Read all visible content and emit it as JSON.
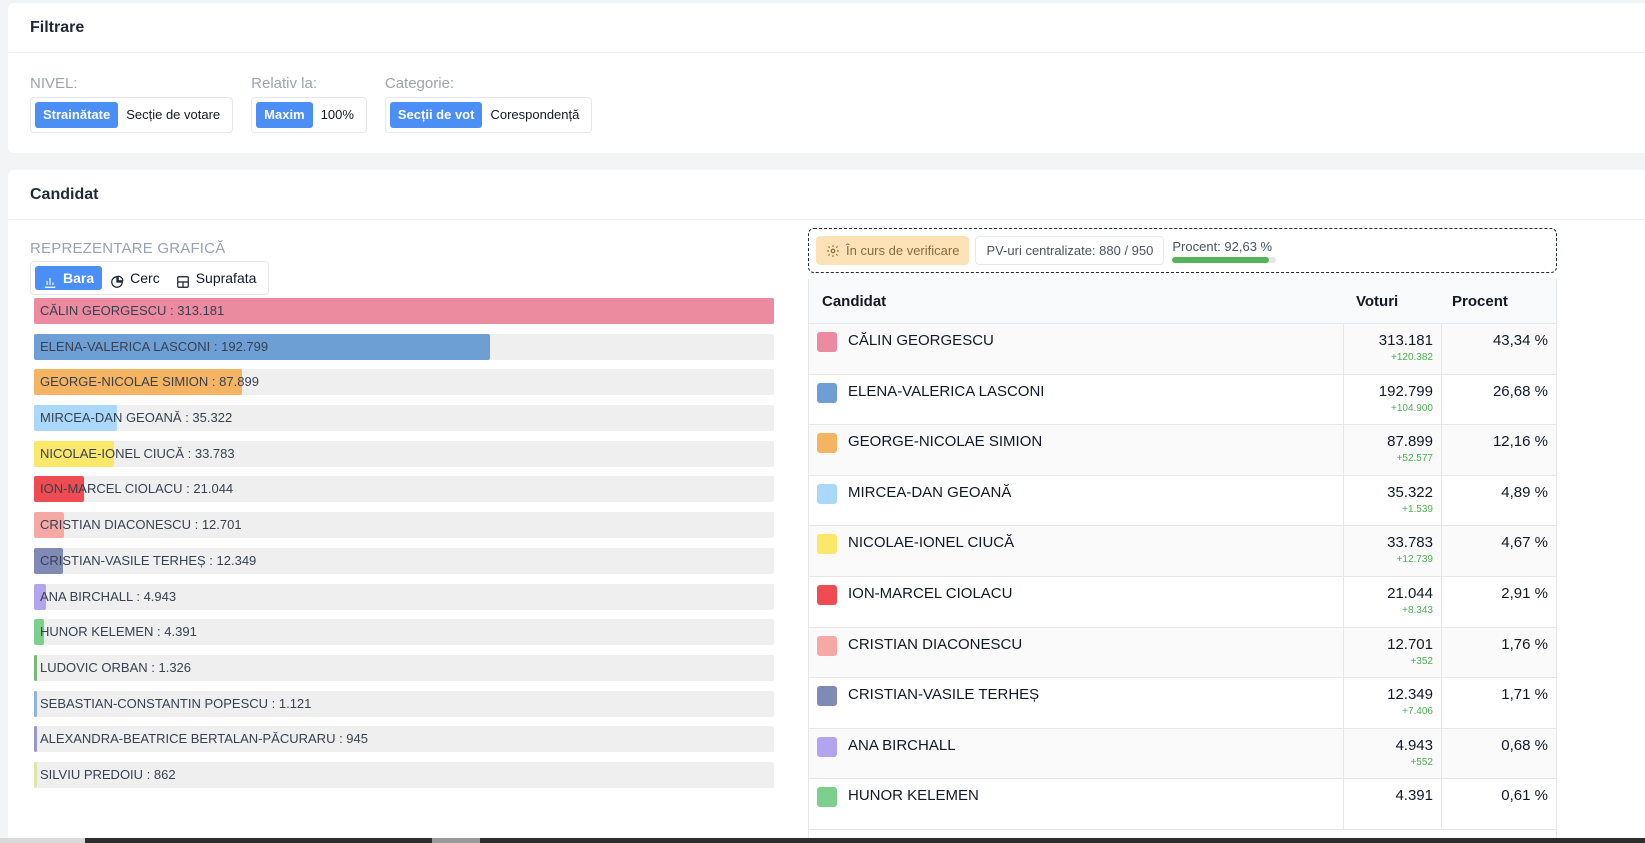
{
  "filters": {
    "title": "Filtrare",
    "groups": [
      {
        "label": "NIVEL:",
        "options": [
          "Strainătate",
          "Secție de votare"
        ],
        "active": 0
      },
      {
        "label": "Relativ la:",
        "options": [
          "Maxim",
          "100%"
        ],
        "active": 0
      },
      {
        "label": "Categorie:",
        "options": [
          "Secții de vot",
          "Corespondență"
        ],
        "active": 0
      }
    ]
  },
  "candidat": {
    "title": "Candidat",
    "chart_label": "REPREZENTARE GRAFICĂ",
    "chart_types": [
      "Bara",
      "Cerc",
      "Suprafata"
    ],
    "chart_type_icons": [
      "bar-chart-icon",
      "pie-chart-icon",
      "area-chart-icon"
    ],
    "active_chart_type": 0,
    "status": {
      "badge": "În curs de verificare",
      "badge_icon": "gear-icon",
      "pv": "PV-uri centralizate: 880 / 950",
      "percent_text": "Procent: 92,63 %",
      "percent_value": 92.63
    },
    "table": {
      "headers": [
        "Candidat",
        "Voturi",
        "Procent"
      ],
      "rows": [
        {
          "name": "CĂLIN GEORGESCU",
          "votes": "313.181",
          "delta": "+120.382",
          "pct": "43,34 %",
          "color": "#ec8aa0"
        },
        {
          "name": "ELENA-VALERICA LASCONI",
          "votes": "192.799",
          "delta": "+104.900",
          "pct": "26,68 %",
          "color": "#6e9fd4"
        },
        {
          "name": "GEORGE-NICOLAE SIMION",
          "votes": "87.899",
          "delta": "+52.577",
          "pct": "12,16 %",
          "color": "#f5b461"
        },
        {
          "name": "MIRCEA-DAN GEOANĂ",
          "votes": "35.322",
          "delta": "+1.539",
          "pct": "4,89 %",
          "color": "#a9d8fb"
        },
        {
          "name": "NICOLAE-IONEL CIUCĂ",
          "votes": "33.783",
          "delta": "+12.739",
          "pct": "4,67 %",
          "color": "#fbe86a"
        },
        {
          "name": "ION-MARCEL CIOLACU",
          "votes": "21.044",
          "delta": "+8.343",
          "pct": "2,91 %",
          "color": "#ee4c52"
        },
        {
          "name": "CRISTIAN DIACONESCU",
          "votes": "12.701",
          "delta": "+352",
          "pct": "1,76 %",
          "color": "#f6a9a4"
        },
        {
          "name": "CRISTIAN-VASILE TERHEȘ",
          "votes": "12.349",
          "delta": "+7.406",
          "pct": "1,71 %",
          "color": "#7f8ab5"
        },
        {
          "name": "ANA BIRCHALL",
          "votes": "4.943",
          "delta": "+552",
          "pct": "0,68 %",
          "color": "#b3a4ef"
        },
        {
          "name": "HUNOR KELEMEN",
          "votes": "4.391",
          "delta": "",
          "pct": "0,61 %",
          "color": "#7ccf8d"
        }
      ]
    }
  },
  "chart_data": {
    "type": "bar",
    "orientation": "horizontal",
    "categories": [
      "CĂLIN GEORGESCU",
      "ELENA-VALERICA LASCONI",
      "GEORGE-NICOLAE SIMION",
      "MIRCEA-DAN GEOANĂ",
      "NICOLAE-IONEL CIUCĂ",
      "ION-MARCEL CIOLACU",
      "CRISTIAN DIACONESCU",
      "CRISTIAN-VASILE TERHEȘ",
      "ANA BIRCHALL",
      "HUNOR KELEMEN",
      "LUDOVIC ORBAN",
      "SEBASTIAN-CONSTANTIN POPESCU",
      "ALEXANDRA-BEATRICE BERTALAN-PĂCURARU",
      "SILVIU PREDOIU"
    ],
    "values": [
      313181,
      192799,
      87899,
      35322,
      33783,
      21044,
      12701,
      12349,
      4943,
      4391,
      1326,
      1121,
      945,
      862
    ],
    "labels": [
      "313.181",
      "192.799",
      "87.899",
      "35.322",
      "33.783",
      "21.044",
      "12.701",
      "12.349",
      "4.943",
      "4.391",
      "1.326",
      "1.121",
      "945",
      "862"
    ],
    "colors": [
      "#ec8aa0",
      "#6e9fd4",
      "#f5b461",
      "#a9d8fb",
      "#fbe86a",
      "#ee4c52",
      "#f6a9a4",
      "#7f8ab5",
      "#b3a4ef",
      "#7ccf8d",
      "#7ab57a",
      "#8fb5dd",
      "#9b95c9",
      "#dfe6a7"
    ],
    "xlim": [
      0,
      313181
    ],
    "grid": false
  }
}
